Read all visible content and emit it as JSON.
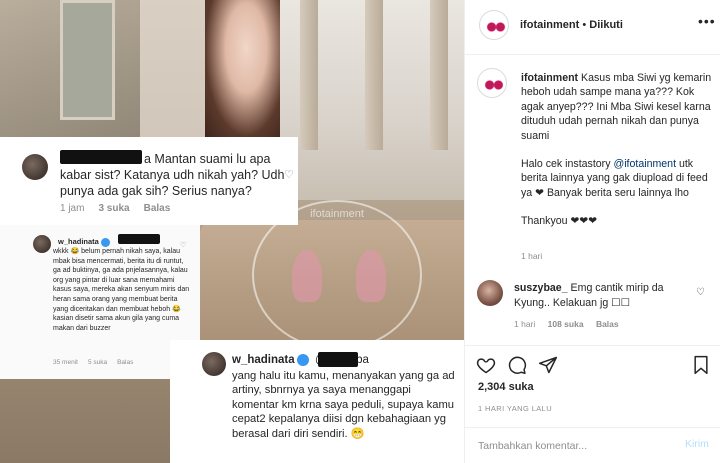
{
  "post": {
    "username": "ifotainment",
    "follow_status": "Diikuti",
    "separator": "•"
  },
  "media": {
    "watermark_text": "ifotainment",
    "card1": {
      "text": "a Mantan suami lu apa kabar sist? Katanya udh nikah yah? Udh punya ada gak sih? Serius nanya?",
      "time": "1 jam",
      "likes": "3 suka",
      "reply": "Balas"
    },
    "card2": {
      "username": "w_hadinata",
      "text": "wkkk 😂 belum pernah nikah saya, kalau mbak bisa mencermati, berita itu di runtut, ga ad buktinya, ga ada pnjelasannya, kalau org yang pintar di luar sana memahami kasus saya, mereka akan senyum miris dan heran sama orang yang membuat berita yang diceritakan dan membuat heboh 😂 kasian disetir sama akun gila yang cuma makan dari buzzer",
      "time": "35 menit",
      "likes": "5 suka",
      "reply": "Balas"
    },
    "card3": {
      "username": "w_hadinata",
      "tag": "@ ...purba",
      "text": "yang halu itu kamu, menanyakan yang ga ad artiny, sbnrnya ya saya menanggapi komentar km krna saya peduli, supaya kamu cepat2 kepalanya diisi dgn kebahagiaan yg berasal dari diri sendiri. 😁"
    }
  },
  "caption": {
    "username": "ifotainment",
    "paragraph1": "Kasus mba Siwi yg kemarin heboh udah sampe mana ya??? Kok agak anyep??? Ini Mba Siwi kesel karna dituduh udah pernah nikah dan punya suami",
    "paragraph2_before": "Halo cek instastory ",
    "paragraph2_mention": "@ifotainment",
    "paragraph2_after": " utk berita lainnya yang gak diupload di feed ya ❤ Banyak berita seru lainnya lho",
    "paragraph3": "Thankyou ❤❤❤",
    "time": "1 hari"
  },
  "comment": {
    "username": "suszybae_",
    "text": "Emg cantik mirip da Kyung.. Kelakuan jg ☐☐",
    "time": "1 hari",
    "likes": "108 suka",
    "reply": "Balas"
  },
  "actions": {
    "likes": "2,304 suka",
    "date": "1 HARI YANG LALU"
  },
  "add_comment": {
    "placeholder": "Tambahkan komentar...",
    "post_label": "Kirim"
  },
  "colors": {
    "link": "#003569",
    "muted": "#8e8e8e",
    "verified": "#3897f0",
    "post_disabled": "#b2dffc"
  }
}
